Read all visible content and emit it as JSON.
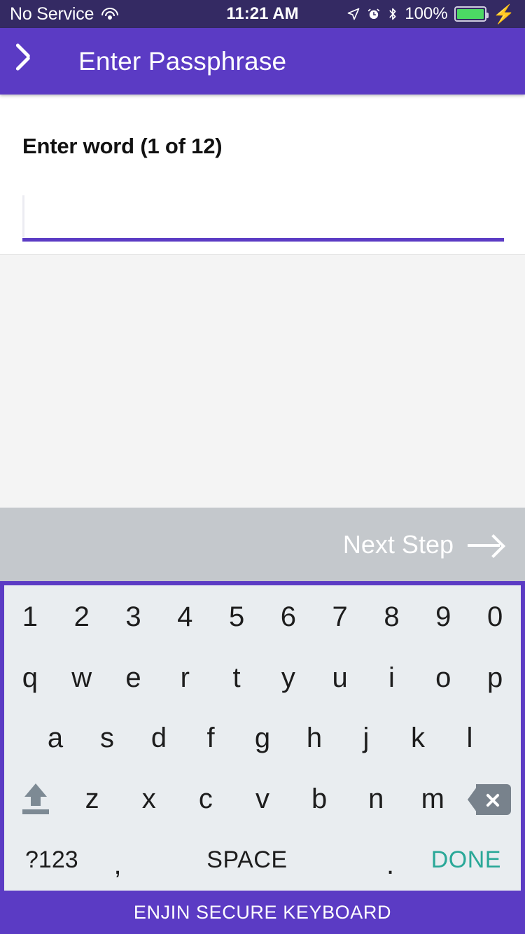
{
  "status_bar": {
    "carrier": "No Service",
    "wifi_icon": "wifi-icon",
    "time": "11:21 AM",
    "location_icon": "location-arrow-icon",
    "alarm_icon": "alarm-clock-icon",
    "bluetooth_icon": "bluetooth-icon",
    "battery_percent": "100%",
    "battery_icon": "battery-full-icon",
    "charging_icon": "lightning-bolt-icon",
    "background_color": "#342a63",
    "text_color": "#ffffff"
  },
  "app_bar": {
    "back_icon": "back-chevron-icon",
    "title": "Enter Passphrase",
    "background_color": "#5b3bc4",
    "text_color": "#ffffff"
  },
  "main": {
    "prompt_label": "Enter word (1 of 12)",
    "word_index": 1,
    "word_total": 12,
    "input": {
      "value": "",
      "placeholder": "",
      "underline_color": "#5b3bc4"
    }
  },
  "next_step": {
    "label": "Next Step",
    "arrow_icon": "arrow-right-icon",
    "background_color": "#c4c8cc",
    "text_color": "#ffffff",
    "enabled": false
  },
  "keyboard": {
    "border_color": "#5b3bc4",
    "background_color": "#e9edf0",
    "key_text_color": "#1d1d1d",
    "rows": {
      "numbers": [
        "1",
        "2",
        "3",
        "4",
        "5",
        "6",
        "7",
        "8",
        "9",
        "0"
      ],
      "top": [
        "q",
        "w",
        "e",
        "r",
        "t",
        "y",
        "u",
        "i",
        "o",
        "p"
      ],
      "home": [
        "a",
        "s",
        "d",
        "f",
        "g",
        "h",
        "j",
        "k",
        "l"
      ],
      "bottom_letters": [
        "z",
        "x",
        "c",
        "v",
        "b",
        "n",
        "m"
      ]
    },
    "shift_icon": "shift-icon",
    "backspace_icon": "backspace-icon",
    "function_row": {
      "symbols_label": "?123",
      "comma_label": ",",
      "space_label": "SPACE",
      "period_label": ".",
      "done_label": "DONE",
      "done_color": "#2aa898"
    },
    "footer_label": "ENJIN SECURE KEYBOARD",
    "footer_background": "#5b3bc4"
  }
}
